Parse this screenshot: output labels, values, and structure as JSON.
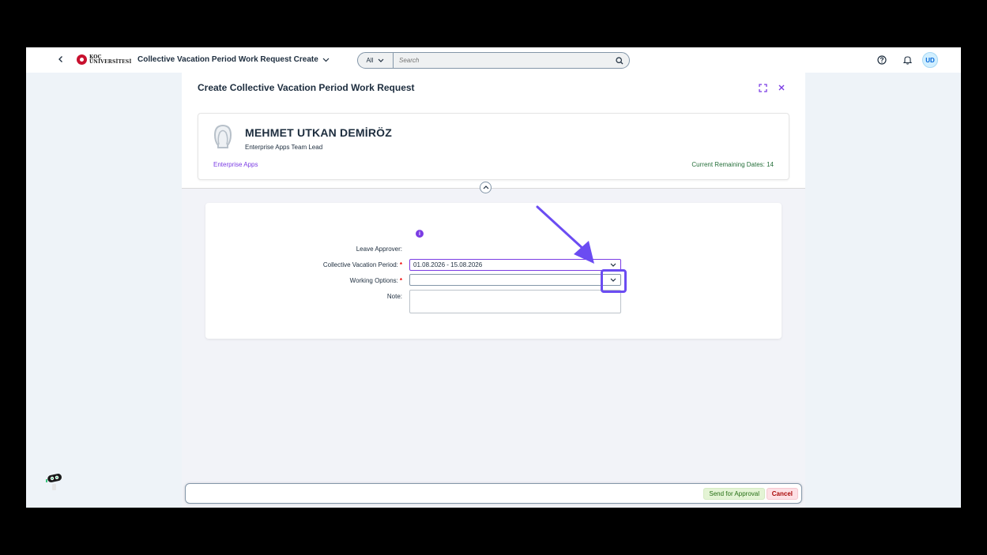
{
  "shell": {
    "logo_line1": "KOÇ",
    "logo_line2": "ÜNİVERSİTESİ",
    "app_title": "Collective Vacation Period Work Request Create",
    "search_scope": "All",
    "search_placeholder": "Search",
    "avatar_initials": "UD"
  },
  "dialog": {
    "title": "Create Collective Vacation Period Work Request",
    "profile": {
      "name": "MEHMET UTKAN DEMİRÖZ",
      "role": "Enterprise Apps Team Lead",
      "department": "Enterprise Apps",
      "remaining": "Current Remaining Dates: 14"
    },
    "form": {
      "info_glyph": "i",
      "leave_approver_label": "Leave Approver:",
      "period_label": "Collective Vacation Period:",
      "period_value": "01.08.2026 - 15.08.2026",
      "working_options_label": "Working Options:",
      "working_options_value": "",
      "note_label": "Note:",
      "required_marker": "*"
    }
  },
  "footer": {
    "send_label": "Send for Approval",
    "cancel_label": "Cancel"
  },
  "colors": {
    "accent": "#7b3ce4",
    "annotation": "#6b4cf2",
    "approve_bg": "#e4f4d5",
    "cancel_bg": "#fde0e5"
  }
}
